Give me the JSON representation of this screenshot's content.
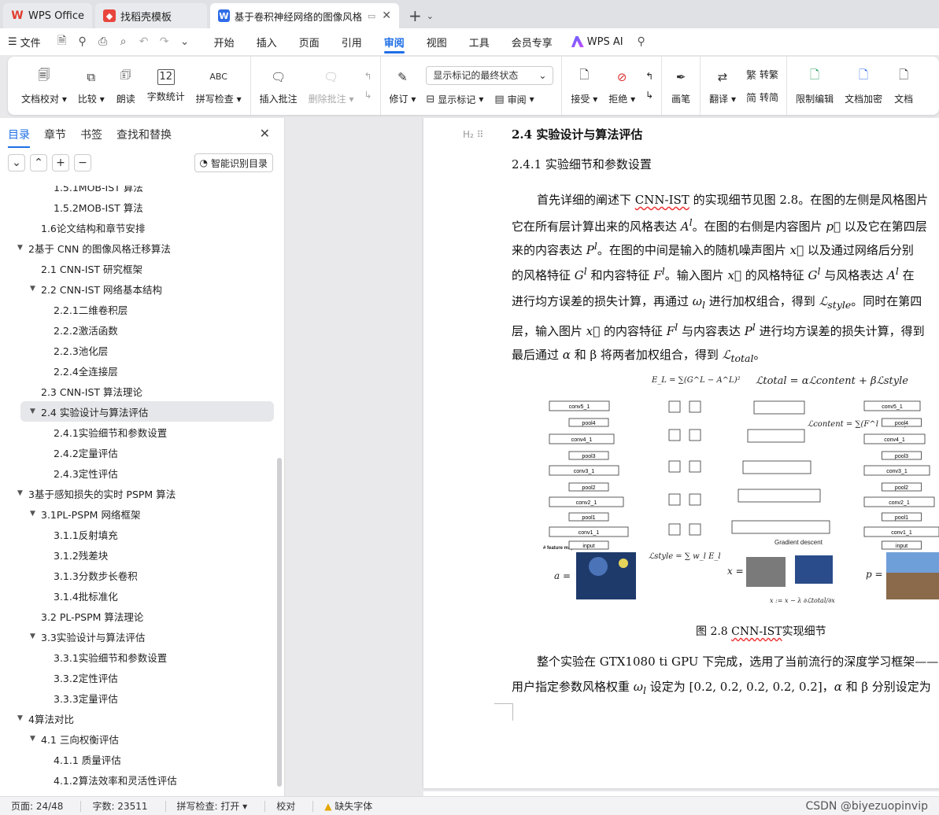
{
  "tabs": [
    {
      "label": "WPS Office",
      "icon": "wps-logo-icon"
    },
    {
      "label": "找稻壳模板",
      "icon": "docer-icon"
    },
    {
      "label": "基于卷积神经网络的图像风格迁",
      "icon": "writer-doc-icon",
      "active": true
    }
  ],
  "menu": {
    "file": "文件",
    "tabs": [
      "开始",
      "插入",
      "页面",
      "引用",
      "审阅",
      "视图",
      "工具",
      "会员专享"
    ],
    "active": "审阅",
    "ai": "WPS AI"
  },
  "ribbon": {
    "doc_check": "文档校对",
    "compare": "比较",
    "read_aloud": "朗读",
    "word_count": "字数统计",
    "spell_check": "拼写检查",
    "insert_comment": "插入批注",
    "delete_comment": "删除批注",
    "revise": "修订",
    "display_select": "显示标记的最终状态",
    "show_marks": "显示标记",
    "review": "审阅",
    "accept": "接受",
    "reject": "拒绝",
    "brush": "画笔",
    "translate": "翻译",
    "to_traditional": "转繁",
    "to_simplified": "转简",
    "restrict_edit": "限制编辑",
    "encrypt": "文档加密",
    "doc_more": "文档"
  },
  "nav": {
    "tabs": [
      "目录",
      "章节",
      "书签",
      "查找和替换"
    ],
    "smart_button": "智能识别目录",
    "toc": [
      {
        "label": "1.5.1MOB-IST 算法",
        "level": 3,
        "tri": ""
      },
      {
        "label": "1.5.2MOB-IST 算法",
        "level": 3,
        "tri": ""
      },
      {
        "label": "1.6论文结构和章节安排",
        "level": 2,
        "tri": ""
      },
      {
        "label": "2基于 CNN 的图像风格迁移算法",
        "level": 1,
        "tri": "▼"
      },
      {
        "label": "2.1  CNN-IST  研究框架",
        "level": 2,
        "tri": ""
      },
      {
        "label": "2.2  CNN-IST  网络基本结构",
        "level": 2,
        "tri": "▼"
      },
      {
        "label": "2.2.1二维卷积层",
        "level": 3,
        "tri": ""
      },
      {
        "label": "2.2.2激活函数",
        "level": 3,
        "tri": ""
      },
      {
        "label": "2.2.3池化层",
        "level": 3,
        "tri": ""
      },
      {
        "label": "2.2.4全连接层",
        "level": 3,
        "tri": ""
      },
      {
        "label": "2.3  CNN-IST  算法理论",
        "level": 2,
        "tri": ""
      },
      {
        "label": "2.4  实验设计与算法评估",
        "level": 2,
        "tri": "▼",
        "selected": true
      },
      {
        "label": "2.4.1实验细节和参数设置",
        "level": 3,
        "tri": ""
      },
      {
        "label": "2.4.2定量评估",
        "level": 3,
        "tri": ""
      },
      {
        "label": "2.4.3定性评估",
        "level": 3,
        "tri": ""
      },
      {
        "label": "3基于感知损失的实时 PSPM 算法",
        "level": 1,
        "tri": "▼"
      },
      {
        "label": "3.1PL-PSPM  网络框架",
        "level": 2,
        "tri": "▼"
      },
      {
        "label": "3.1.1反射填充",
        "level": 3,
        "tri": ""
      },
      {
        "label": "3.1.2残差块",
        "level": 3,
        "tri": ""
      },
      {
        "label": "3.1.3分数步长卷积",
        "level": 3,
        "tri": ""
      },
      {
        "label": "3.1.4批标准化",
        "level": 3,
        "tri": ""
      },
      {
        "label": "3.2  PL-PSPM 算法理论",
        "level": 2,
        "tri": ""
      },
      {
        "label": "3.3实验设计与算法评估",
        "level": 2,
        "tri": "▼"
      },
      {
        "label": "3.3.1实验细节和参数设置",
        "level": 3,
        "tri": ""
      },
      {
        "label": "3.3.2定性评估",
        "level": 3,
        "tri": ""
      },
      {
        "label": "3.3.3定量评估",
        "level": 3,
        "tri": ""
      },
      {
        "label": "4算法对比",
        "level": 1,
        "tri": "▼"
      },
      {
        "label": "4.1   三向权衡评估",
        "level": 2,
        "tri": "▼"
      },
      {
        "label": "4.1.1  质量评估",
        "level": 3,
        "tri": ""
      },
      {
        "label": "4.1.2算法效率和灵活性评估",
        "level": 3,
        "tri": ""
      }
    ]
  },
  "doc": {
    "h2_marker": "H₂ ⠿",
    "heading2": "2.4  实验设计与算法评估",
    "heading3": "2.4.1      实验细节和参数设置",
    "caption_prefix": "图 2.8   ",
    "caption_link": "CNN-IST",
    "caption_suffix": "实现细节",
    "fig": {
      "eq_top": "ℒtotal = αℒcontent + βℒstyle",
      "eq_el": "E_L = ∑(G^L − A^L)²",
      "eq_content": "ℒcontent = ∑(F^l − P^l)²",
      "eq_style": "ℒstyle = ∑ w_l E_l",
      "update": "x := x − λ ∂ℒtotal/∂x",
      "gradient": "Gradient descent",
      "feature_maps": "# feature maps",
      "layers": [
        "conv5_1",
        "pool4",
        "conv4_1",
        "pool3",
        "conv3_1",
        "pool2",
        "conv2_1",
        "pool1",
        "conv1_1",
        "input"
      ],
      "left_label": "a =",
      "mid_label": "x =",
      "right_label": "p ="
    }
  },
  "status": {
    "page": "页面: 24/48",
    "words": "字数: 23511",
    "spell": "拼写检查: 打开",
    "proof": "校对",
    "missing_font": "缺失字体",
    "watermark": "CSDN @biyezuopinvip"
  }
}
